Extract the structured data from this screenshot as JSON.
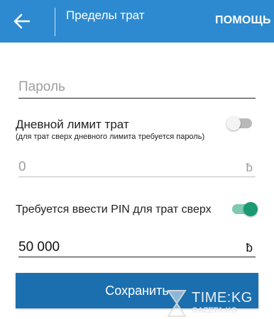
{
  "header": {
    "title": "Пределы трат",
    "help_label": "ПОМОЩЬ",
    "back_icon": "arrow-left-icon",
    "background": "#2d8ad0"
  },
  "password": {
    "placeholder": "Пароль"
  },
  "daily_limit": {
    "title": "Дневной лимит трат",
    "hint": "(для трат сверх дневного лимита требуется пароль)",
    "enabled": false,
    "value": "0",
    "currency": "ƀ"
  },
  "pin": {
    "label": "Требуется ввести PIN для трат сверх",
    "enabled": true,
    "amount": "50 000",
    "currency": "ƀ",
    "accent": "#1a9a72"
  },
  "save": {
    "label": "Сохранить",
    "background": "#1b6fae"
  },
  "watermark": {
    "text": "TIME:KG",
    "sub": "GAZETA.KG"
  }
}
